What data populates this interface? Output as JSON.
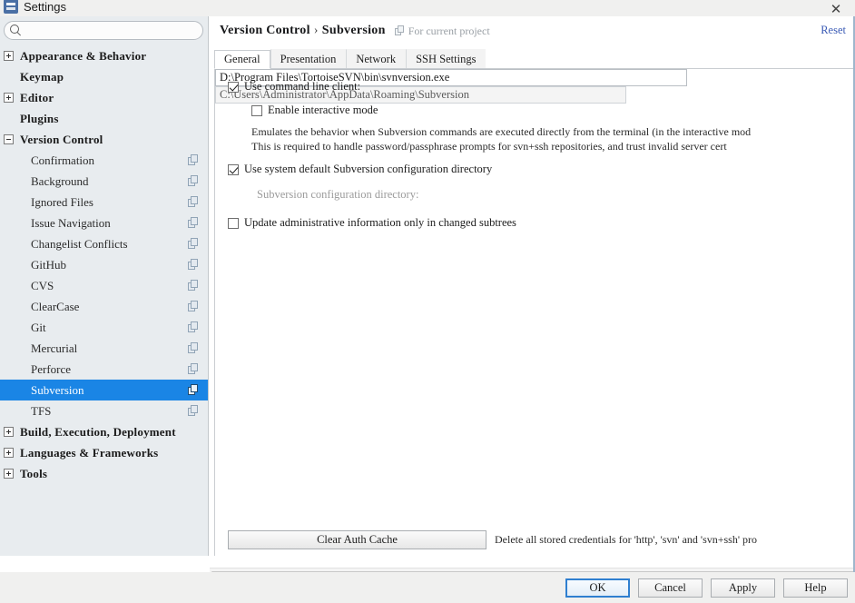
{
  "window": {
    "title": "Settings",
    "close_label": "✕",
    "app_icon": "settings-app-icon"
  },
  "sidebar": {
    "search": {
      "value": "",
      "placeholder": ""
    },
    "items": [
      {
        "label": "Appearance & Behavior",
        "level": "top",
        "expandable": true,
        "expanded": false,
        "scope_icon": false,
        "selected": false
      },
      {
        "label": "Keymap",
        "level": "top",
        "expandable": false,
        "expanded": false,
        "scope_icon": false,
        "selected": false
      },
      {
        "label": "Editor",
        "level": "top",
        "expandable": true,
        "expanded": false,
        "scope_icon": false,
        "selected": false
      },
      {
        "label": "Plugins",
        "level": "top",
        "expandable": false,
        "expanded": false,
        "scope_icon": false,
        "selected": false
      },
      {
        "label": "Version Control",
        "level": "top",
        "expandable": true,
        "expanded": true,
        "scope_icon": false,
        "selected": false
      },
      {
        "label": "Confirmation",
        "level": "child",
        "expandable": false,
        "expanded": false,
        "scope_icon": true,
        "selected": false
      },
      {
        "label": "Background",
        "level": "child",
        "expandable": false,
        "expanded": false,
        "scope_icon": true,
        "selected": false
      },
      {
        "label": "Ignored Files",
        "level": "child",
        "expandable": false,
        "expanded": false,
        "scope_icon": true,
        "selected": false
      },
      {
        "label": "Issue Navigation",
        "level": "child",
        "expandable": false,
        "expanded": false,
        "scope_icon": true,
        "selected": false
      },
      {
        "label": "Changelist Conflicts",
        "level": "child",
        "expandable": false,
        "expanded": false,
        "scope_icon": true,
        "selected": false
      },
      {
        "label": "GitHub",
        "level": "child",
        "expandable": false,
        "expanded": false,
        "scope_icon": true,
        "selected": false
      },
      {
        "label": "CVS",
        "level": "child",
        "expandable": false,
        "expanded": false,
        "scope_icon": true,
        "selected": false
      },
      {
        "label": "ClearCase",
        "level": "child",
        "expandable": false,
        "expanded": false,
        "scope_icon": true,
        "selected": false
      },
      {
        "label": "Git",
        "level": "child",
        "expandable": false,
        "expanded": false,
        "scope_icon": true,
        "selected": false
      },
      {
        "label": "Mercurial",
        "level": "child",
        "expandable": false,
        "expanded": false,
        "scope_icon": true,
        "selected": false
      },
      {
        "label": "Perforce",
        "level": "child",
        "expandable": false,
        "expanded": false,
        "scope_icon": true,
        "selected": false
      },
      {
        "label": "Subversion",
        "level": "child",
        "expandable": false,
        "expanded": false,
        "scope_icon": true,
        "selected": true
      },
      {
        "label": "TFS",
        "level": "child",
        "expandable": false,
        "expanded": false,
        "scope_icon": true,
        "selected": false
      },
      {
        "label": "Build, Execution, Deployment",
        "level": "top",
        "expandable": true,
        "expanded": false,
        "scope_icon": false,
        "selected": false
      },
      {
        "label": "Languages & Frameworks",
        "level": "top",
        "expandable": true,
        "expanded": false,
        "scope_icon": false,
        "selected": false
      },
      {
        "label": "Tools",
        "level": "top",
        "expandable": true,
        "expanded": false,
        "scope_icon": false,
        "selected": false
      }
    ]
  },
  "main": {
    "breadcrumb_parent": "Version Control",
    "breadcrumb_separator": "›",
    "breadcrumb_current": "Subversion",
    "scope_note": "For current project",
    "reset_label": "Reset",
    "tabs": [
      {
        "label": "General",
        "active": true
      },
      {
        "label": "Presentation",
        "active": false
      },
      {
        "label": "Network",
        "active": false
      },
      {
        "label": "SSH Settings",
        "active": false
      }
    ],
    "use_command_line_client": {
      "label": "Use command line client:",
      "checked": true,
      "path_value": "D:\\Program Files\\TortoiseSVN\\bin\\svnversion.exe"
    },
    "enable_interactive_mode": {
      "label": "Enable interactive mode",
      "checked": false
    },
    "interactive_desc_line1": "Emulates the behavior when Subversion commands are executed directly from the terminal (in the interactive mod",
    "interactive_desc_line2": "This is required to handle password/passphrase prompts for svn+ssh repositories, and trust invalid server cert",
    "use_system_default_config": {
      "label": "Use system default Subversion configuration directory",
      "checked": true
    },
    "config_directory": {
      "label": "Subversion configuration directory:",
      "value": "C:\\Users\\Administrator\\AppData\\Roaming\\Subversion"
    },
    "update_admin_info": {
      "label": "Update administrative information only in changed subtrees",
      "checked": false
    },
    "clear_auth_cache_button": "Clear Auth Cache",
    "clear_auth_cache_note": "Delete all stored credentials for 'http', 'svn' and 'svn+ssh' pro"
  },
  "footer": {
    "buttons": [
      {
        "label": "OK",
        "default": true
      },
      {
        "label": "Cancel",
        "default": false
      },
      {
        "label": "Apply",
        "default": false
      },
      {
        "label": "Help",
        "default": false
      }
    ]
  },
  "colors": {
    "selection": "#1a85e5",
    "link": "#3b5bb5",
    "sidebar_bg": "#e8ecef",
    "default_button_border": "#2f7fd0"
  }
}
